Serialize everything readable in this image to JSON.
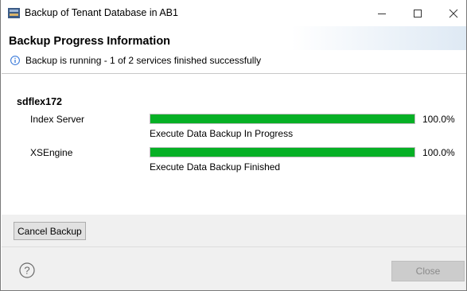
{
  "window": {
    "title": "Backup of Tenant Database in AB1"
  },
  "header": {
    "title": "Backup Progress Information",
    "message": "Backup is running - 1 of 2 services finished successfully"
  },
  "host": "sdflex172",
  "services": [
    {
      "name": "Index Server",
      "progress": 1.0,
      "percent_label": "100.0%",
      "status": "Execute Data Backup In Progress"
    },
    {
      "name": "XSEngine",
      "progress": 1.0,
      "percent_label": "100.0%",
      "status": "Execute Data Backup Finished"
    }
  ],
  "buttons": {
    "cancel": "Cancel Backup",
    "close": "Close"
  },
  "colors": {
    "progress_fill": "#06b025",
    "footer_bg": "#f0f0f0"
  },
  "icons": {
    "app": "database-icon",
    "info": "info-icon",
    "help": "help-icon",
    "minimize": "minimize-icon",
    "maximize": "maximize-icon",
    "close": "close-icon"
  }
}
